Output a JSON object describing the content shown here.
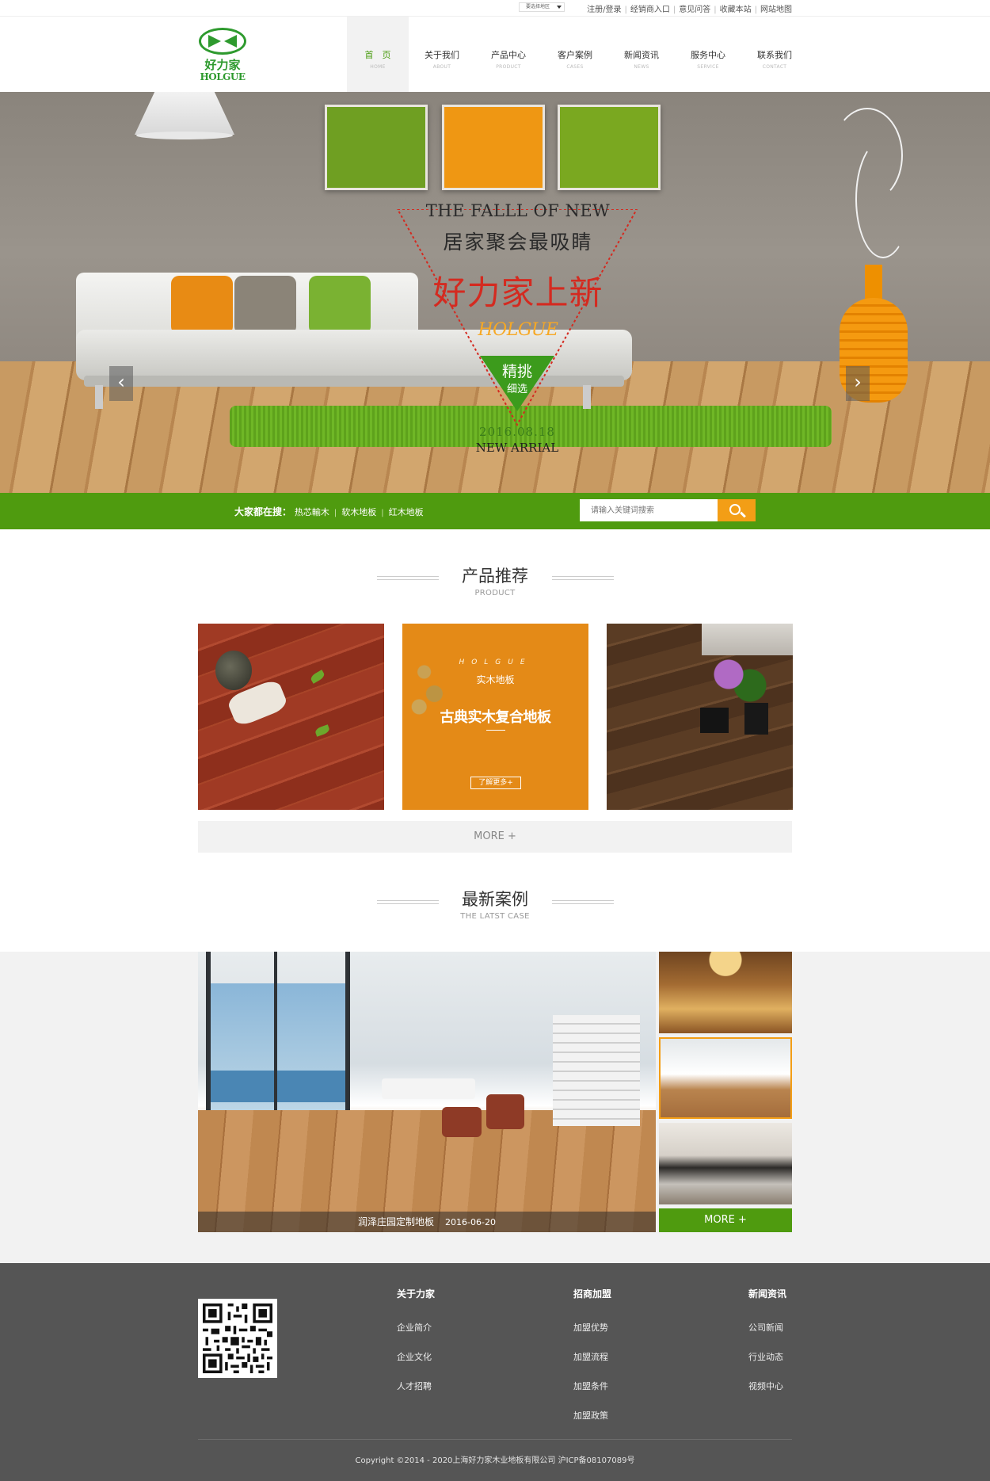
{
  "topbar": {
    "region_select": "要选择地区",
    "links": [
      "注册/登录",
      "经销商入口",
      "意见问答",
      "收藏本站",
      "网站地图"
    ]
  },
  "logo": {
    "cn": "好力家",
    "en": "HOLGUE"
  },
  "nav": [
    {
      "cn": "首　页",
      "en": "HOME",
      "active": true
    },
    {
      "cn": "关于我们",
      "en": "ABOUT"
    },
    {
      "cn": "产品中心",
      "en": "PRODUCT"
    },
    {
      "cn": "客户案例",
      "en": "CASES"
    },
    {
      "cn": "新闻资讯",
      "en": "NEWS"
    },
    {
      "cn": "服务中心",
      "en": "SERVICE"
    },
    {
      "cn": "联系我们",
      "en": "CONTACT"
    }
  ],
  "hero": {
    "line1": "THE FALLL OF NEW",
    "line2": "居家聚会最吸睛",
    "line3": "好力家上新",
    "brand": "HOLGUE",
    "badge1": "精挑",
    "badge2": "细选",
    "date": "2016.08.18",
    "new": "NEW ARRIAL",
    "prev_arrow": "‹",
    "next_arrow": "›",
    "slides": 5,
    "active_slide": 3
  },
  "search": {
    "hot_label": "大家都在搜：",
    "hot_terms": [
      "热芯輸木",
      "软木地板",
      "红木地板"
    ],
    "placeholder": "请输入关键词搜索"
  },
  "products_section": {
    "title": "产品推荐",
    "subtitle": "PRODUCT",
    "featured": {
      "brand": "HOLGUE",
      "sub": "实木地板",
      "title": "古典实木复合地板",
      "more": "了解更多+"
    },
    "more": "MORE +"
  },
  "cases_section": {
    "title": "最新案例",
    "subtitle": "THE LATST CASE",
    "caption": "润泽庄园定制地板",
    "caption_date": "2016-06-20",
    "more": "MORE +"
  },
  "footer": {
    "columns": [
      {
        "head": "关于力家",
        "links": [
          "企业简介",
          "企业文化",
          "人才招聘"
        ]
      },
      {
        "head": "招商加盟",
        "links": [
          "加盟优势",
          "加盟流程",
          "加盟条件",
          "加盟政策"
        ]
      },
      {
        "head": "新闻资讯",
        "links": [
          "公司新闻",
          "行业动态",
          "视频中心"
        ]
      }
    ],
    "copyright": "Copyright ©2014 - 2020上海好力家木业地板有限公司  沪ICP备08107089号"
  },
  "colors": {
    "brand_green": "#4f9b0f",
    "accent_orange": "#f39e16",
    "hero_red": "#d42a20",
    "footer_bg": "#555555"
  }
}
